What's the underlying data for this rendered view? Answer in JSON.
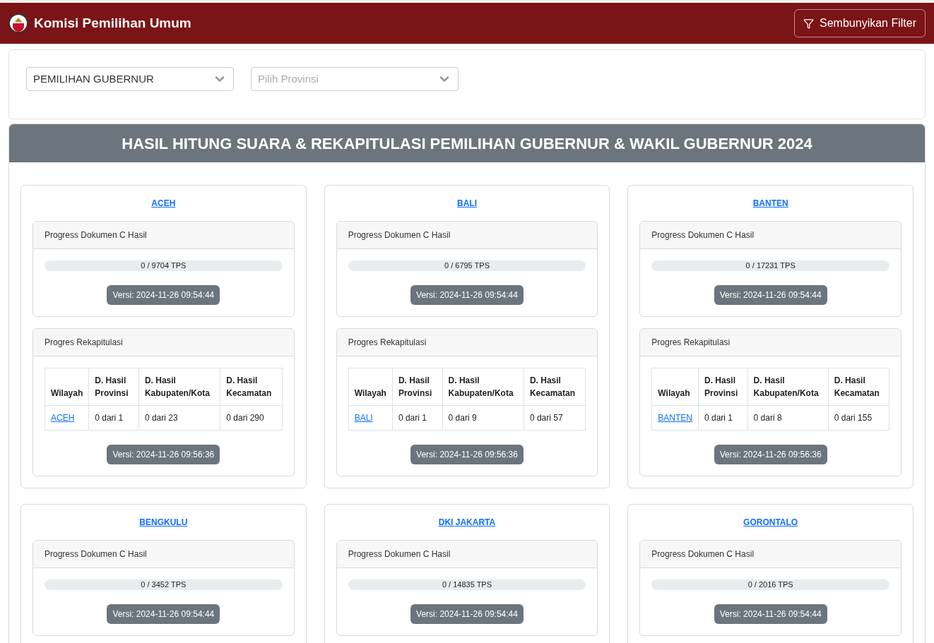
{
  "header": {
    "title": "Komisi Pemilihan Umum",
    "filter_button": "Sembunyikan Filter"
  },
  "filters": [
    {
      "value": "PEMILIHAN GUBERNUR"
    },
    {
      "placeholder": "Pilih Provinsi"
    }
  ],
  "banner": "HASIL HITUNG SUARA & REKAPITULASI PEMILIHAN GUBERNUR & WAKIL GUBERNUR 2024",
  "provinces": [
    {
      "name": "ACEH",
      "doc_progress": {
        "heading": "Progress Dokumen C Hasil",
        "label": "0 / 9704 TPS",
        "level": 0,
        "version": "Versi: 2024-11-26 09:54:44"
      },
      "recap": {
        "heading": "Progres Rekapitulasi",
        "columns": [
          "Wilayah",
          "D. Hasil Provinsi",
          "D. Hasil Kabupaten/Kota",
          "D. Hasil Kecamatan"
        ],
        "rows": [
          [
            "ACEH",
            "0 dari 1",
            "0 dari 23",
            "0 dari 290"
          ]
        ],
        "version": "Versi: 2024-11-26 09:56:36"
      }
    },
    {
      "name": "BALI",
      "doc_progress": {
        "heading": "Progress Dokumen C Hasil",
        "label": "0 / 6795 TPS",
        "level": 0,
        "version": "Versi: 2024-11-26 09:54:44"
      },
      "recap": {
        "heading": "Progres Rekapitulasi",
        "columns": [
          "Wilayah",
          "D. Hasil Provinsi",
          "D. Hasil Kabupaten/Kota",
          "D. Hasil Kecamatan"
        ],
        "rows": [
          [
            "BALI",
            "0 dari 1",
            "0 dari 9",
            "0 dari 57"
          ]
        ],
        "version": "Versi: 2024-11-26 09:56:36"
      }
    },
    {
      "name": "BANTEN",
      "doc_progress": {
        "heading": "Progress Dokumen C Hasil",
        "label": "0 / 17231 TPS",
        "level": 0,
        "version": "Versi: 2024-11-26 09:54:44"
      },
      "recap": {
        "heading": "Progres Rekapitulasi",
        "columns": [
          "Wilayah",
          "D. Hasil Provinsi",
          "D. Hasil Kabupaten/Kota",
          "D. Hasil Kecamatan"
        ],
        "rows": [
          [
            "BANTEN",
            "0 dari 1",
            "0 dari 8",
            "0 dari 155"
          ]
        ],
        "version": "Versi: 2024-11-26 09:56:36"
      }
    },
    {
      "name": "BENGKULU",
      "doc_progress": {
        "heading": "Progress Dokumen C Hasil",
        "label": "0 / 3452 TPS",
        "level": 0,
        "version": "Versi: 2024-11-26 09:54:44"
      }
    },
    {
      "name": "DKI JAKARTA",
      "doc_progress": {
        "heading": "Progress Dokumen C Hasil",
        "label": "0 / 14835 TPS",
        "level": 0,
        "version": "Versi: 2024-11-26 09:54:44"
      }
    },
    {
      "name": "GORONTALO",
      "doc_progress": {
        "heading": "Progress Dokumen C Hasil",
        "label": "0 / 2016 TPS",
        "level": 0,
        "version": "Versi: 2024-11-26 09:54:44"
      }
    }
  ]
}
